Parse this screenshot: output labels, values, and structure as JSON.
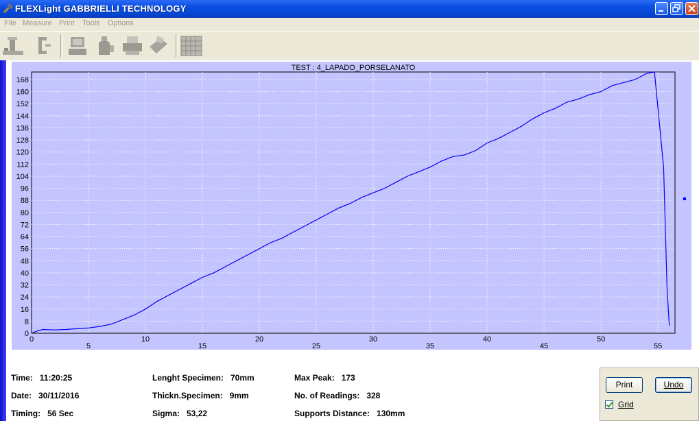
{
  "window": {
    "title": "FLEXLight GABBRIELLI TECHNOLOGY"
  },
  "menu": [
    {
      "label": "File"
    },
    {
      "label": "Measure"
    },
    {
      "label": "Print"
    },
    {
      "label": "Tools"
    },
    {
      "label": "Options"
    }
  ],
  "toolbar": [
    {
      "icon": "new-test-icon"
    },
    {
      "icon": "clamp-icon"
    },
    {
      "icon": "computer-icon"
    },
    {
      "icon": "bottle-icon"
    },
    {
      "icon": "printer-icon"
    },
    {
      "icon": "fax-icon"
    },
    {
      "icon": "grid-icon"
    }
  ],
  "colors": {
    "plot_bg": "#c4c4ff",
    "line": "#0000ff",
    "titlebar": "#0a4ee0"
  },
  "chart_data": {
    "type": "line",
    "title": "TEST : 4_LAPADO_PORSELANATO",
    "xlabel": "",
    "ylabel": "",
    "xlim": [
      0,
      56.5
    ],
    "ylim": [
      0,
      173
    ],
    "x_ticks": [
      0,
      5,
      10,
      15,
      20,
      25,
      30,
      35,
      40,
      45,
      50,
      55
    ],
    "y_ticks": [
      0,
      8,
      16,
      24,
      32,
      40,
      48,
      56,
      64,
      72,
      80,
      88,
      96,
      104,
      112,
      120,
      128,
      136,
      144,
      152,
      160,
      168
    ],
    "grid": true,
    "series": [
      {
        "x": [
          0,
          0.5,
          1,
          2,
          3,
          4,
          5,
          6,
          7,
          8,
          9,
          10,
          11,
          12,
          13,
          14,
          15,
          16,
          17,
          18,
          19,
          20,
          21,
          22,
          23,
          24,
          25,
          26,
          27,
          28,
          29,
          30,
          31,
          32,
          33,
          34,
          35,
          36,
          37,
          38,
          39,
          40,
          41,
          42,
          43,
          44,
          45,
          46,
          47,
          48,
          49,
          50,
          51,
          52,
          53,
          54,
          54.7,
          55.5,
          55.8,
          56
        ],
        "y": [
          0,
          1.5,
          2.5,
          2.2,
          2.5,
          3,
          3.5,
          4.5,
          6,
          9,
          12,
          16,
          21,
          25,
          29,
          33,
          37,
          40,
          44,
          48,
          52,
          56,
          60,
          63,
          67,
          71,
          75,
          79,
          83,
          86,
          90,
          93,
          96,
          100,
          104,
          107,
          110,
          114,
          117,
          118,
          121,
          126,
          129,
          133,
          137,
          142,
          146,
          149,
          153,
          155,
          158,
          160,
          164,
          166,
          168,
          172,
          173,
          110,
          30,
          5
        ]
      }
    ]
  },
  "marker": {
    "y": 89
  },
  "info": {
    "time": "Time:   11:20:25",
    "date": "Date:   30/11/2016",
    "timing": "Timing:   56 Sec",
    "length": "Lenght Specimen:   70mm",
    "thickness": "Thickn.Specimen:   9mm",
    "sigma": "Sigma:   53,22",
    "max_peak": "Max Peak:   173",
    "readings": "No. of Readings:   328",
    "supports": "Supports Distance:   130mm"
  },
  "panel": {
    "print_label": "Print",
    "undo_label": "Undo",
    "grid_label": "Grid",
    "grid_checked": true
  }
}
